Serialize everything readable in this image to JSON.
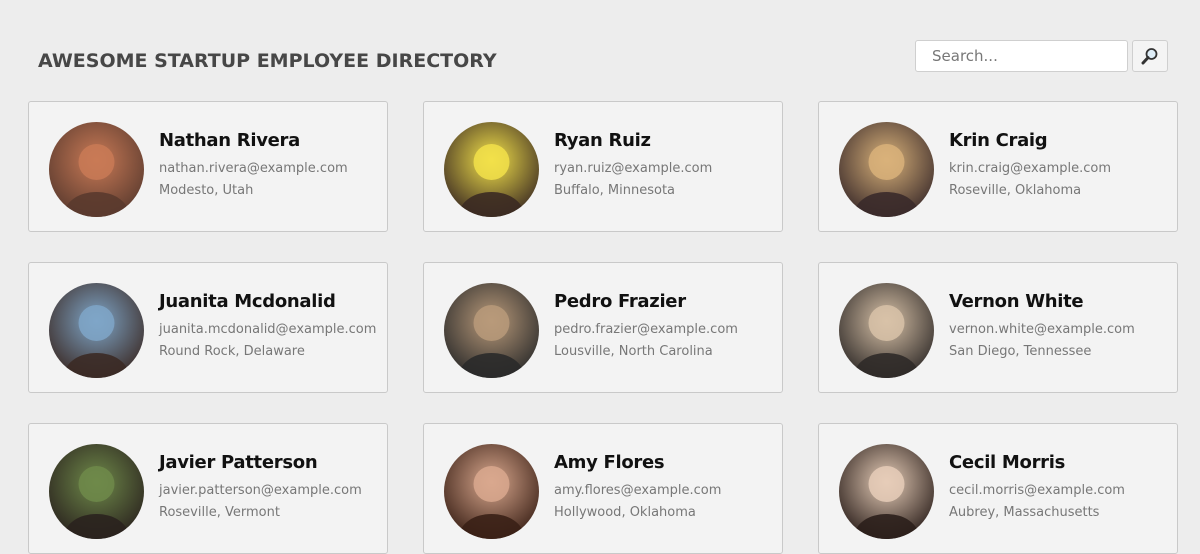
{
  "header": {
    "title": "AWESOME STARTUP EMPLOYEE DIRECTORY",
    "search_placeholder": "Search...",
    "search_icon": "search-icon"
  },
  "employees": [
    {
      "name": "Nathan Rivera",
      "email": "nathan.rivera@example.com",
      "location": "Modesto, Utah",
      "avatar_colors": [
        "#c97a56",
        "#5a3a2e"
      ]
    },
    {
      "name": "Ryan Ruiz",
      "email": "ryan.ruiz@example.com",
      "location": "Buffalo, Minnesota",
      "avatar_colors": [
        "#f2e14a",
        "#3b2a22"
      ]
    },
    {
      "name": "Krin Craig",
      "email": "krin.craig@example.com",
      "location": "Roseville, Oklahoma",
      "avatar_colors": [
        "#d9b27a",
        "#3a2a2a"
      ]
    },
    {
      "name": "Juanita Mcdonalid",
      "email": "juanita.mcdonalid@example.com",
      "location": "Round Rock, Delaware",
      "avatar_colors": [
        "#7fa6c8",
        "#3b2a25"
      ]
    },
    {
      "name": "Pedro Frazier",
      "email": "pedro.frazier@example.com",
      "location": "Lousville, North Carolina",
      "avatar_colors": [
        "#b99a7a",
        "#2a2a2a"
      ]
    },
    {
      "name": "Vernon White",
      "email": "vernon.white@example.com",
      "location": "San Diego, Tennessee",
      "avatar_colors": [
        "#d8c2a8",
        "#2f2a28"
      ]
    },
    {
      "name": "Javier Patterson",
      "email": "javier.patterson@example.com",
      "location": "Roseville, Vermont",
      "avatar_colors": [
        "#6f8a4a",
        "#2a221e"
      ]
    },
    {
      "name": "Amy Flores",
      "email": "amy.flores@example.com",
      "location": "Hollywood, Oklahoma",
      "avatar_colors": [
        "#d9a88e",
        "#3a2016"
      ]
    },
    {
      "name": "Cecil Morris",
      "email": "cecil.morris@example.com",
      "location": "Aubrey, Massachusetts",
      "avatar_colors": [
        "#e6cdb8",
        "#2b1f1b"
      ]
    }
  ]
}
